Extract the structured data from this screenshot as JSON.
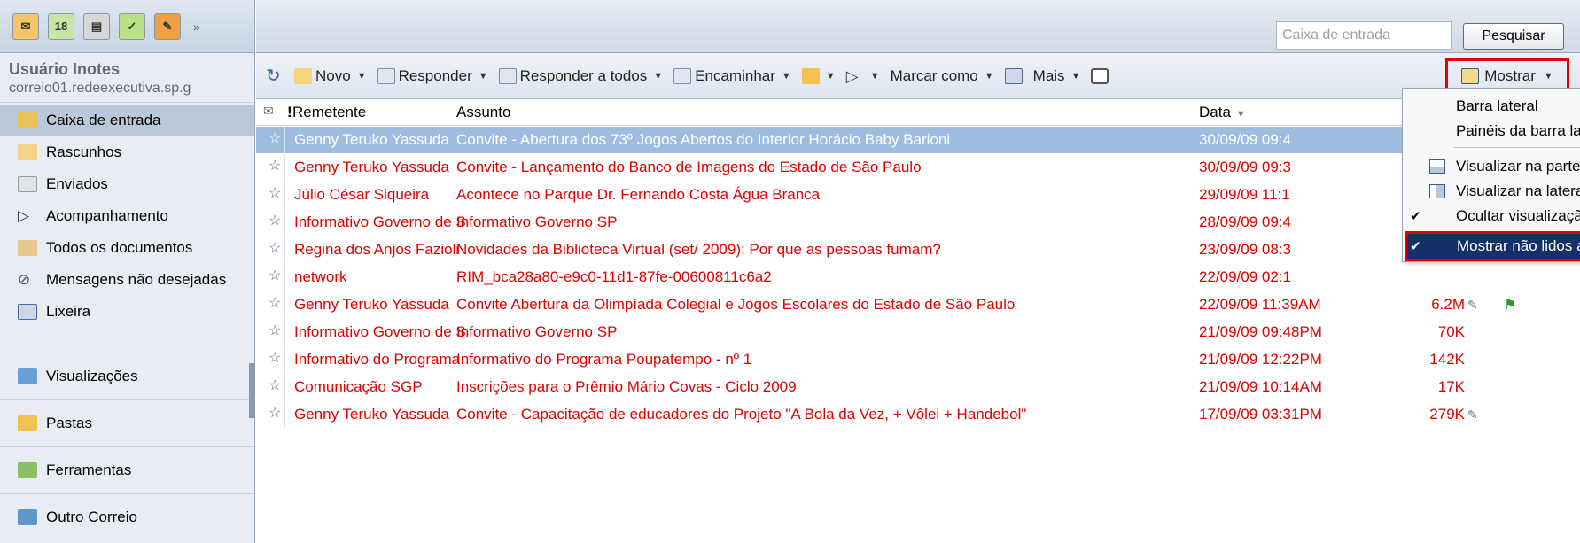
{
  "colors": {
    "unread": "#e00000",
    "selected_row": "#9cbde0",
    "highlight_box": "#e00000",
    "menu_highlight": "#14306a"
  },
  "sidebar": {
    "user_name": "Usuário Inotes",
    "user_email": "correio01.redeexecutiva.sp.g",
    "folders": [
      {
        "label": "Caixa de entrada",
        "icon": "inbox-icon"
      },
      {
        "label": "Rascunhos",
        "icon": "drafts-icon"
      },
      {
        "label": "Enviados",
        "icon": "sent-icon"
      },
      {
        "label": "Acompanhamento",
        "icon": "followup-flag-icon"
      },
      {
        "label": "Todos os documentos",
        "icon": "all-documents-icon"
      },
      {
        "label": "Mensagens não desejadas",
        "icon": "junk-icon"
      },
      {
        "label": "Lixeira",
        "icon": "trash-icon"
      }
    ],
    "sections": [
      "Visualizações",
      "Pastas",
      "Ferramentas",
      "Outro Correio"
    ]
  },
  "search": {
    "placeholder": "Caixa de entrada",
    "button": "Pesquisar"
  },
  "toolbar": {
    "new": "Novo",
    "reply": "Responder",
    "reply_all": "Responder a todos",
    "forward": "Encaminhar",
    "mark_as": "Marcar como",
    "more": "Mais",
    "show": "Mostrar"
  },
  "columns": {
    "sender": "Remetente",
    "subject": "Assunto",
    "date": "Data"
  },
  "messages": [
    {
      "from": "Genny Teruko Yassuda",
      "subject": "Convite - Abertura dos 73º Jogos Abertos do Interior Horácio Baby Barioni",
      "date": "30/09/09 09:4",
      "size": ""
    },
    {
      "from": "Genny Teruko Yassuda",
      "subject": "Convite - Lançamento do Banco de Imagens do Estado de São Paulo",
      "date": "30/09/09 09:3",
      "size": ""
    },
    {
      "from": "Júlio César Siqueira",
      "subject": "Acontece no Parque Dr. Fernando Costa Água Branca",
      "date": "29/09/09 11:1",
      "size": ""
    },
    {
      "from": "Informativo Governo de S",
      "subject": "Informativo Governo SP",
      "date": "28/09/09 09:4",
      "size": ""
    },
    {
      "from": "Regina dos Anjos Fazioli",
      "subject": "Novidades da Biblioteca Virtual (set/ 2009): Por que as pessoas fumam?",
      "date": "23/09/09 08:3",
      "size": ""
    },
    {
      "from": "network",
      "subject": "RIM_bca28a80-e9c0-11d1-87fe-00600811c6a2",
      "date": "22/09/09 02:1",
      "size": ""
    },
    {
      "from": "Genny Teruko Yassuda",
      "subject": "Convite Abertura da Olimpíada Colegial e Jogos Escolares do Estado de São Paulo",
      "date": "22/09/09 11:39AM",
      "size": "6.2M"
    },
    {
      "from": "Informativo Governo de S",
      "subject": "Informativo Governo SP",
      "date": "21/09/09 09:48PM",
      "size": "70K"
    },
    {
      "from": "Informativo do Programa",
      "subject": "Informativo do Programa Poupatempo - nº 1",
      "date": "21/09/09 12:22PM",
      "size": "142K"
    },
    {
      "from": "Comunicação SGP",
      "subject": "Inscrições para o Prêmio Mário Covas - Ciclo 2009",
      "date": "21/09/09 10:14AM",
      "size": "17K"
    },
    {
      "from": "Genny Teruko Yassuda",
      "subject": "Convite - Capacitação de educadores do Projeto \"A Bola da Vez, + Vôlei + Handebol\"",
      "date": "17/09/09 03:31PM",
      "size": "279K"
    }
  ],
  "show_menu": {
    "items": [
      {
        "label": "Barra lateral"
      },
      {
        "label": "Painéis da barra lateral"
      },
      {
        "label": "Visualizar na parte inferior"
      },
      {
        "label": "Visualizar na lateral"
      },
      {
        "label": "Ocultar visualização"
      },
      {
        "label": "Mostrar não lidos apenas"
      }
    ]
  }
}
